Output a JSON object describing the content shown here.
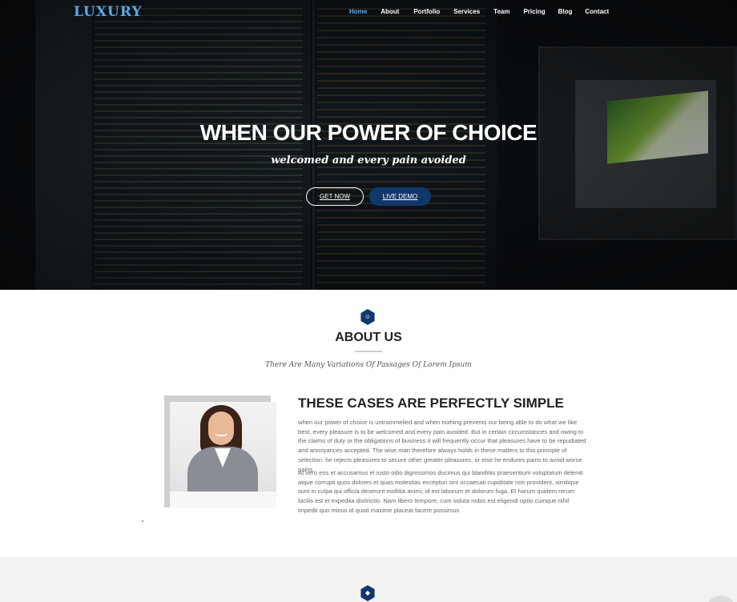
{
  "brand": {
    "logo_text": "LUXURY"
  },
  "nav": {
    "items": [
      {
        "label": "Home",
        "active": true
      },
      {
        "label": "About",
        "active": false
      },
      {
        "label": "Portfolio",
        "active": false
      },
      {
        "label": "Services",
        "active": false
      },
      {
        "label": "Team",
        "active": false
      },
      {
        "label": "Pricing",
        "active": false
      },
      {
        "label": "Blog",
        "active": false
      },
      {
        "label": "Contact",
        "active": false
      }
    ]
  },
  "hero": {
    "title": "WHEN OUR POWER OF CHOICE",
    "subtitle": "welcomed and every pain avoided",
    "primary_button": "GET NOW",
    "secondary_button": "LIVE DEMO"
  },
  "about": {
    "icon": "smiley-icon",
    "title": "ABOUT US",
    "tagline": "There Are Many Variations Of Passages Of Lorem Ipsum",
    "cases_title": "THESE CASES ARE PERFECTLY SIMPLE",
    "paragraph_1": "when our power of choice is untrammelled and when nothing prevents our being able to do what we like best, every pleasure is to be welcomed and every pain avoided. But in certain circumstances and owing to the claims of duty or the obligations of business it will frequently occur that pleasures have to be repudiated and annoyances accepted. The wise man therefore always holds in these matters to this principle of selection: he rejects pleasures to secure other greater pleasures, or else he endures pains to avoid worse pains.",
    "paragraph_2": "At vero eos et accusamus et iusto odio dignissimos ducimus qui blanditiis praesentium voluptatum deleniti atque corrupti quos dolores et quas molestias excepturi sint occaecati cupiditate non provident, similique sunt in culpa qui officia deserunt mollitia animi, id est laborum et dolorum fuga. Et harum quidem rerum facilis est et expedita distinctio. Nam libero tempore, cum soluta nobis est eligendi optio cumque nihil impedit quo minus id quod maxime placeat facere possimus"
  },
  "next_section": {
    "icon": "hexagon-icon"
  },
  "colors": {
    "accent": "#5aa8e6",
    "brand_navy": "#11386b"
  }
}
